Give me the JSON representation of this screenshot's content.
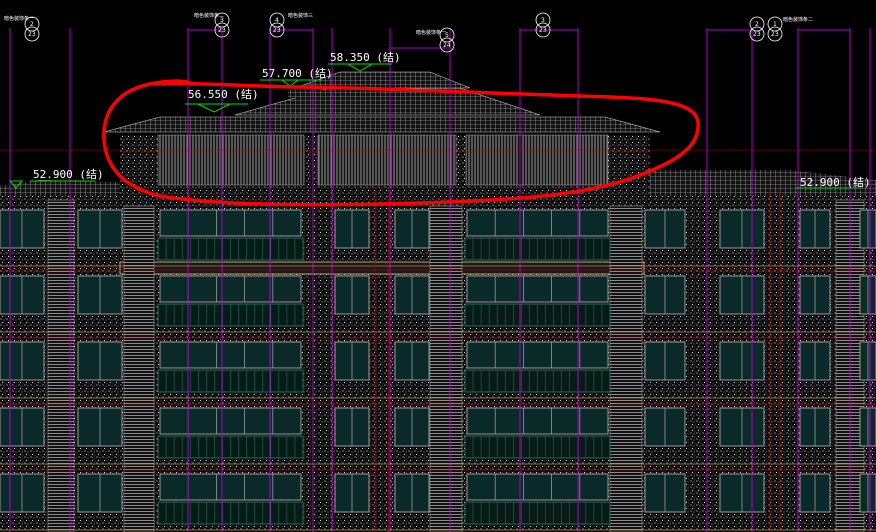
{
  "drawing": {
    "background": "#000000",
    "colors": {
      "axis": "#b000d0",
      "grid_red": "#c00000",
      "roof": "#cfcfcf",
      "stucco": "#d0d0d0",
      "window_frame": "#9a9a9a",
      "glass": "#0a2a2a",
      "railing": "#1f6f5f",
      "band": "#c8a060",
      "elev_mark": "#00e000",
      "markup": "#ff0000"
    },
    "elevation_labels": [
      {
        "id": "elev-52900-left",
        "text": "52.900 (结)"
      },
      {
        "id": "elev-56550",
        "text": "56.550 (结)"
      },
      {
        "id": "elev-57700",
        "text": "57.700 (结)"
      },
      {
        "id": "elev-58350",
        "text": "58.350 (结)"
      },
      {
        "id": "elev-52900-right",
        "text": "52.900 (结)"
      }
    ],
    "axis_bubbles": [
      {
        "id": "bubble-1",
        "top": "2",
        "bottom": "23"
      },
      {
        "id": "bubble-2",
        "top": "3",
        "bottom": "23"
      },
      {
        "id": "bubble-3",
        "top": "4",
        "bottom": "23"
      },
      {
        "id": "bubble-4",
        "top": "5",
        "bottom": "24"
      },
      {
        "id": "bubble-5",
        "top": "3",
        "bottom": "23"
      },
      {
        "id": "bubble-6",
        "top": "2",
        "bottom": "23"
      },
      {
        "id": "bubble-7",
        "top": "1",
        "bottom": "23"
      }
    ],
    "tag_texts": [
      {
        "id": "tag-1",
        "text": "暗色装饰条一"
      },
      {
        "id": "tag-2",
        "text": "暗色装饰条二"
      },
      {
        "id": "tag-3",
        "text": "暗色装饰三"
      },
      {
        "id": "tag-4",
        "text": "暗色装饰条一"
      },
      {
        "id": "tag-5",
        "text": "暗色装饰条二"
      }
    ]
  }
}
